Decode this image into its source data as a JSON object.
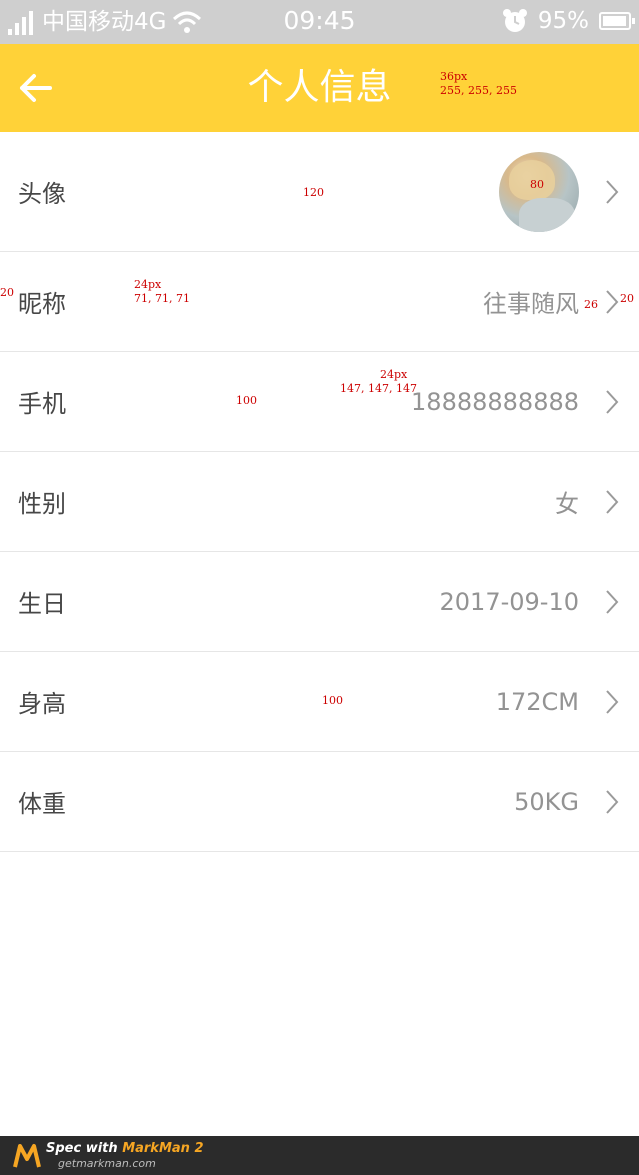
{
  "status_bar": {
    "carrier": "中国移动4G",
    "time": "09:45",
    "battery": "95%",
    "battery_level": 0.95,
    "icons": [
      "signal-icon",
      "wifi-icon",
      "alarm-icon",
      "battery-icon"
    ]
  },
  "header": {
    "title": "个人信息",
    "back_icon": "arrow-left-icon",
    "annotation": {
      "size": "36px",
      "color": "255, 255, 255"
    },
    "background": "#ffd238"
  },
  "rows": [
    {
      "label": "头像",
      "type": "avatar"
    },
    {
      "label": "昵称",
      "value": "往事随风"
    },
    {
      "label": "手机",
      "value": "18888888888"
    },
    {
      "label": "性别",
      "value": "女"
    },
    {
      "label": "生日",
      "value": "2017-09-10"
    },
    {
      "label": "身高",
      "value": "172CM"
    },
    {
      "label": "体重",
      "value": "50KG"
    }
  ],
  "spec": {
    "avatar_row_height": "120",
    "avatar_width": "80",
    "row_height_a": "100",
    "row_height_b": "100",
    "left_margin": "20",
    "right_margin": "20",
    "chevron_gap": "26",
    "label_annotation": {
      "size": "24px",
      "color": "71, 71, 71"
    },
    "value_annotation": {
      "size": "24px",
      "color": "147, 147, 147"
    }
  },
  "footer": {
    "line1_prefix": "Spec with ",
    "line1_brand": "MarkMan 2",
    "line2": "getmarkman.com"
  },
  "colors": {
    "label": "#474747",
    "value": "#939393",
    "accent": "#ffd238"
  }
}
